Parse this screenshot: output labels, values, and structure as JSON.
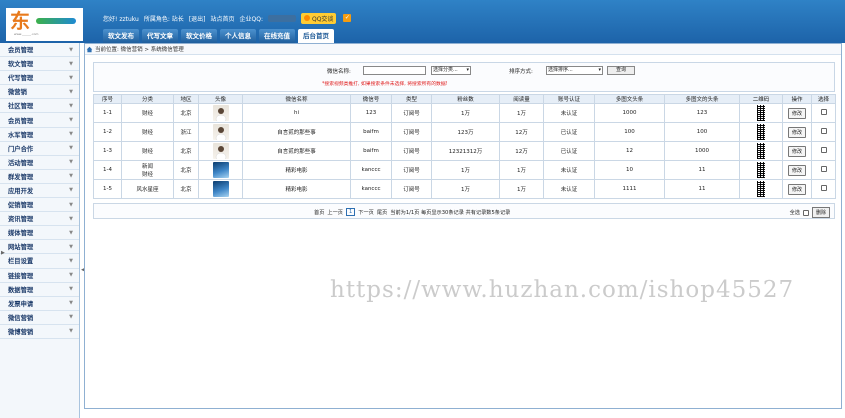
{
  "header": {
    "logo_text": "东",
    "logo_url_text": "www.______.com",
    "greeting": "您好! zztuku",
    "role": "所属角色: 站长",
    "logout": "[退出]",
    "home_link": "站点首页",
    "enterprise_qq_label": "企业QQ:",
    "qq_button": "QQ交谈",
    "nav_tabs": [
      "软文发布",
      "代写文章",
      "软文价格",
      "个人信息",
      "在线充值",
      "后台首页"
    ],
    "active_tab": 5
  },
  "sidebar": {
    "items": [
      "会员管理",
      "软文管理",
      "代写管理",
      "微营销",
      "社区管理",
      "会员管理",
      "水军管理",
      "门户合作",
      "活动管理",
      "群发管理",
      "应用开发",
      "促销管理",
      "资讯管理",
      "媒体管理",
      "网站管理",
      "栏目设置",
      "链接管理",
      "数据管理",
      "发票申请",
      "微信营销",
      "微博营销"
    ]
  },
  "breadcrumb": "当前位置: 微信营销 > 系统微信管理",
  "search": {
    "name_label": "微信名称:",
    "name_value": "",
    "category_select": "选择分类...",
    "sort_label": "排序方式:",
    "sort_select": "选择排序...",
    "query_button": "查询",
    "note": "*搜索视频类推打, 如果搜索条件未选择, 将搜索所有的数据!"
  },
  "table": {
    "headers": [
      "序号",
      "分类",
      "地区",
      "头像",
      "微信名称",
      "微信号",
      "类型",
      "粉丝数",
      "阅读量",
      "账号认证",
      "多图文头条",
      "多图文的头条",
      "二维码",
      "操作",
      "选择"
    ],
    "rows": [
      {
        "no": "1-1",
        "cat": "财经",
        "region": "北京",
        "avatar": "person",
        "name": "hi",
        "wxid": "123",
        "type": "订阅号",
        "fans": "1万",
        "reads": "1万",
        "verified": "未认证",
        "head1": "1000",
        "head2": "123",
        "action": "修改"
      },
      {
        "no": "1-2",
        "cat": "财经",
        "region": "浙江",
        "avatar": "person",
        "name": "自言贰的那些事",
        "wxid": "baifm",
        "type": "订阅号",
        "fans": "123万",
        "reads": "12万",
        "verified": "已认证",
        "head1": "100",
        "head2": "100",
        "action": "修改"
      },
      {
        "no": "1-3",
        "cat": "财经",
        "region": "北京",
        "avatar": "person",
        "name": "自言贰的那些事",
        "wxid": "baifm",
        "type": "订阅号",
        "fans": "12321312万",
        "reads": "12万",
        "verified": "已认证",
        "head1": "12",
        "head2": "1000",
        "action": "修改"
      },
      {
        "no": "1-4",
        "cat": "新闻\n财经",
        "region": "北京",
        "avatar": "movie",
        "name": "精彩电影",
        "wxid": "kanccc",
        "type": "订阅号",
        "fans": "1万",
        "reads": "1万",
        "verified": "未认证",
        "head1": "10",
        "head2": "11",
        "action": "修改"
      },
      {
        "no": "1-5",
        "cat": "风水星座",
        "region": "北京",
        "avatar": "movie",
        "name": "精彩电影",
        "wxid": "kanccc",
        "type": "订阅号",
        "fans": "1万",
        "reads": "1万",
        "verified": "未认证",
        "head1": "1111",
        "head2": "11",
        "action": "修改"
      }
    ]
  },
  "pager": {
    "first": "首页",
    "prev": "上一页",
    "current": "1",
    "next": "下一页",
    "last": "尾页",
    "summary": "当前为1/1页 每页显示30条记录 共有记录数5条记录",
    "select_all": "全选",
    "delete_button": "删除"
  },
  "watermark": "https://www.huzhan.com/ishop45527",
  "colors": {
    "header_blue": "#2f82c6",
    "nav_active_text": "#1e5a97",
    "note_red": "#e02020",
    "logo_orange": "#e87a1c"
  }
}
